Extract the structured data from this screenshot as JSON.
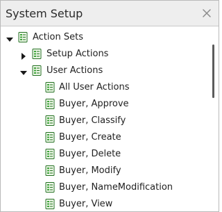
{
  "panel": {
    "title": "System Setup",
    "close_icon": "close-icon"
  },
  "tree": {
    "items": [
      {
        "label": "Action Sets",
        "level": 0,
        "expanded": true,
        "toggle": "expanded"
      },
      {
        "label": "Setup Actions",
        "level": 1,
        "expanded": false,
        "toggle": "collapsed"
      },
      {
        "label": "User Actions",
        "level": 1,
        "expanded": true,
        "toggle": "expanded"
      },
      {
        "label": "All User Actions",
        "level": 2,
        "toggle": "none"
      },
      {
        "label": "Buyer, Approve",
        "level": 2,
        "toggle": "none"
      },
      {
        "label": "Buyer, Classify",
        "level": 2,
        "toggle": "none"
      },
      {
        "label": "Buyer, Create",
        "level": 2,
        "toggle": "none"
      },
      {
        "label": "Buyer, Delete",
        "level": 2,
        "toggle": "none"
      },
      {
        "label": "Buyer, Modify",
        "level": 2,
        "toggle": "none"
      },
      {
        "label": "Buyer, NameModification",
        "level": 2,
        "toggle": "none"
      },
      {
        "label": "Buyer, View",
        "level": 2,
        "toggle": "none"
      }
    ],
    "item_icon": "action-set-icon"
  },
  "scrollbar": {
    "visible": true
  },
  "colors": {
    "header_bg": "#eeeeee",
    "icon_green": "#3ea33a",
    "icon_dark_green": "#1f6e1c",
    "text": "#1f1f1f"
  }
}
